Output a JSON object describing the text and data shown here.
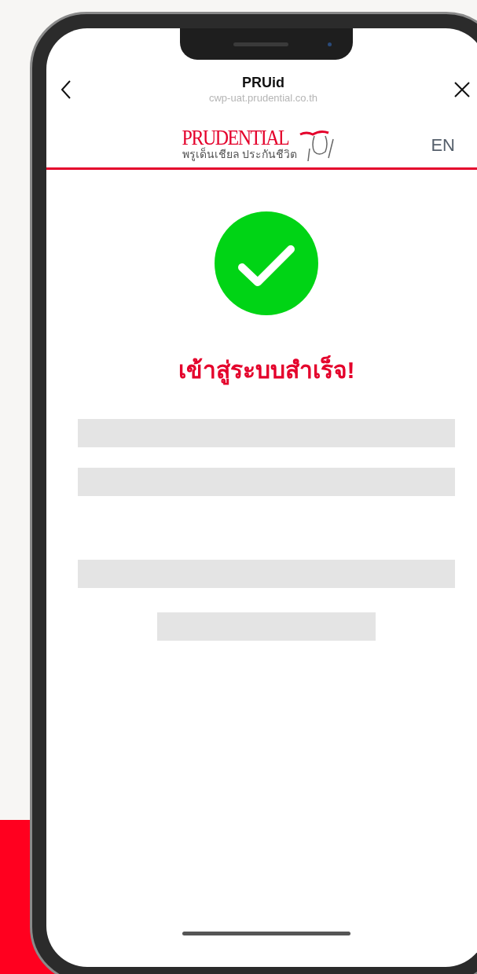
{
  "browser_bar": {
    "title": "PRUid",
    "url": "cwp-uat.prudential.co.th"
  },
  "header": {
    "logo": {
      "wordmark": "PRUDENTIAL",
      "tagline": "พรูเด็นเชียล ประกันชีวิต"
    },
    "language": "EN"
  },
  "status": {
    "message": "เข้าสู่ระบบสำเร็จ!"
  }
}
